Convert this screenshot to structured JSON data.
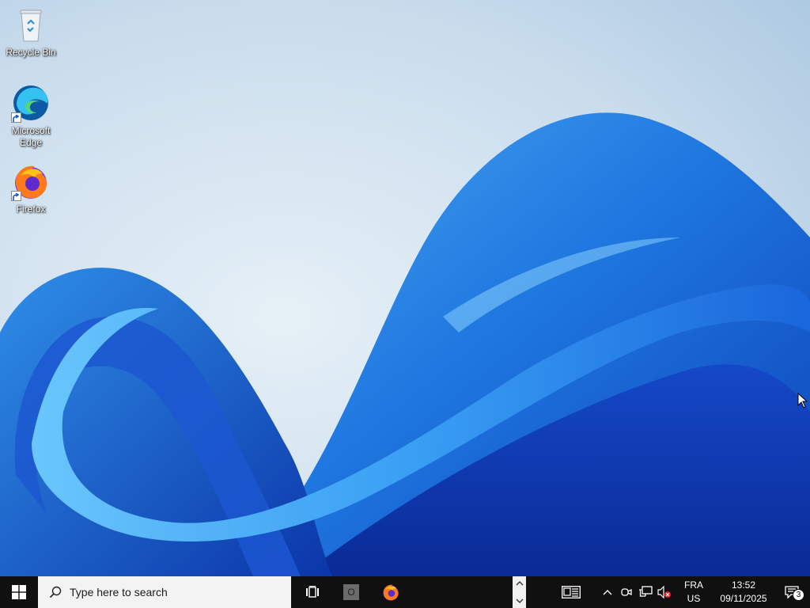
{
  "desktop": {
    "icons": [
      {
        "label": "Recycle Bin",
        "icon": "recycle-bin-icon"
      },
      {
        "label": "Microsoft Edge",
        "icon": "edge-icon"
      },
      {
        "label": "Firefox",
        "icon": "firefox-icon"
      }
    ]
  },
  "taskbar": {
    "search_placeholder": "Type here to search",
    "cortana_glyph": "O",
    "tray": {
      "language_line1": "FRA",
      "language_line2": "US",
      "time": "13:52",
      "date": "09/11/2025",
      "notification_count": "3"
    }
  },
  "colors": {
    "taskbar": "#101010",
    "search_box": "#f3f3f3",
    "wallpaper_sky": "#cfe0ee",
    "wallpaper_blue": "#1a5fd4"
  }
}
